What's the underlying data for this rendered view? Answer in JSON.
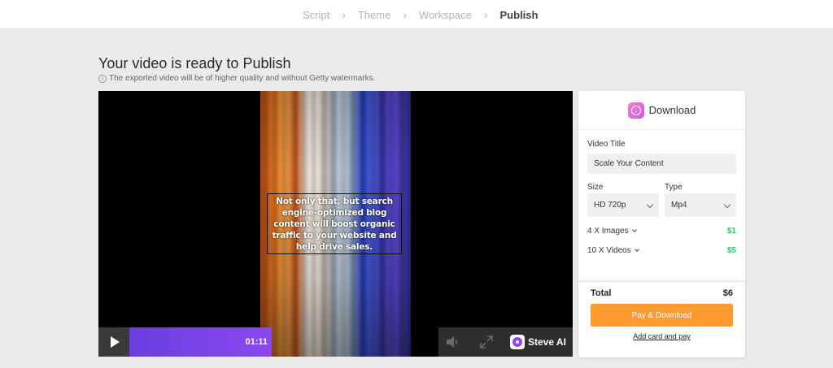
{
  "breadcrumb": {
    "items": [
      {
        "label": "Script"
      },
      {
        "label": "Theme"
      },
      {
        "label": "Workspace"
      },
      {
        "label": "Publish"
      }
    ]
  },
  "page": {
    "title": "Your video is ready to Publish",
    "info": "The exported video will be of higher quality and without Getty watermarks."
  },
  "player": {
    "caption": "Not only that, but search engine-optimized blog content will boost organic traffic to your website and help drive sales.",
    "time": "01:11",
    "progress": 0.46,
    "brand": "Steve AI",
    "icons": {
      "play": "play-icon",
      "volume": "volume-icon",
      "fullscreen": "fullscreen-icon",
      "brand": "steve-ai-logo"
    }
  },
  "download": {
    "title": "Download",
    "icon": "download-icon",
    "video_title_label": "Video Title",
    "video_title_value": "Scale Your Content",
    "size_label": "Size",
    "size_value": "HD 720p",
    "type_label": "Type",
    "type_value": "Mp4",
    "addons": [
      {
        "label": "4 X Images",
        "price": "$1"
      },
      {
        "label": "10 X Videos",
        "price": "$5"
      }
    ],
    "total_label": "Total",
    "total_value": "$6",
    "pay_label": "Pay & Download",
    "add_card_label": "Add card and pay"
  },
  "colors": {
    "accent_orange": "#ff9a2e",
    "progress_purple": "#8a47f0",
    "price_green": "#2ecc71",
    "background": "#ebebeb"
  }
}
